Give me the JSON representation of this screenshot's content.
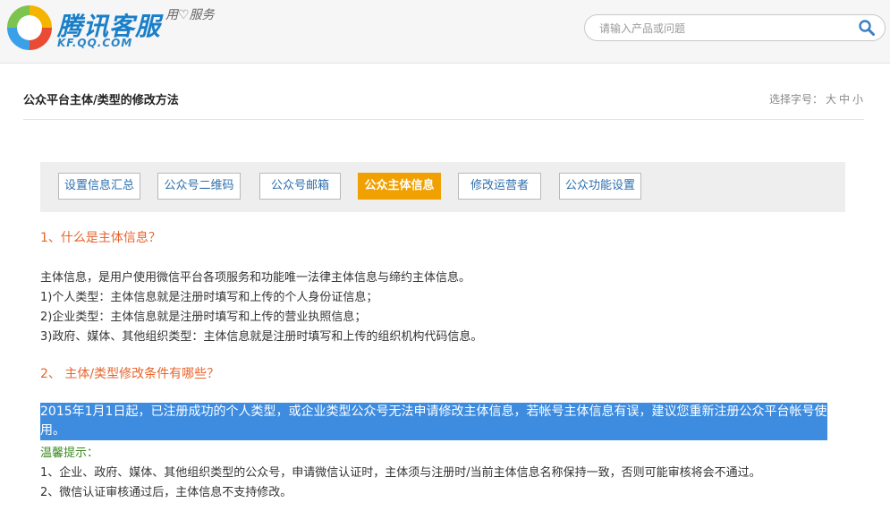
{
  "header": {
    "brand_title": "腾讯客服",
    "brand_domain": "KF.QQ.COM",
    "slogan": "用♡服务",
    "search_placeholder": "请输入产品或问题"
  },
  "article": {
    "title": "公众平台主体/类型的修改方法",
    "font_size_label": "选择字号：",
    "font_sizes": [
      "大",
      "中",
      "小"
    ]
  },
  "tabs": [
    {
      "label": "设置信息汇总",
      "active": false
    },
    {
      "label": "公众号二维码",
      "active": false
    },
    {
      "label": "公众号邮箱",
      "active": false
    },
    {
      "label": "公众主体信息",
      "active": true
    },
    {
      "label": "修改运营者",
      "active": false
    },
    {
      "label": "公众功能设置",
      "active": false
    }
  ],
  "content": {
    "q1": "1、什么是主体信息？",
    "p1": [
      "主体信息，是用户使用微信平台各项服务和功能唯一法律主体信息与缔约主体信息。",
      "1)个人类型：主体信息就是注册时填写和上传的个人身份证信息；",
      "2)企业类型：主体信息就是注册时填写和上传的营业执照信息；",
      "3)政府、媒体、其他组织类型：主体信息就是注册时填写和上传的组织机构代码信息。"
    ],
    "q2": "2、 主体/类型修改条件有哪些？",
    "highlight": "2015年1月1日起，已注册成功的个人类型，或企业类型公众号无法申请修改主体信息，若帐号主体信息有误，建议您重新注册公众平台帐号使用。",
    "tip_title": "温馨提示：",
    "tips": [
      "1、企业、政府、媒体、其他组织类型的公众号，申请微信认证时，主体须与注册时/当前主体信息名称保持一致，否则可能审核将会不通过。",
      "2、微信认证审核通过后，主体信息不支持修改。"
    ]
  },
  "colors": {
    "brand_blue": "#1a7fc9",
    "question_orange": "#e8642c",
    "tab_active": "#f0a000",
    "highlight_blue": "#3e8ce0",
    "tip_green": "#3c8a21"
  }
}
